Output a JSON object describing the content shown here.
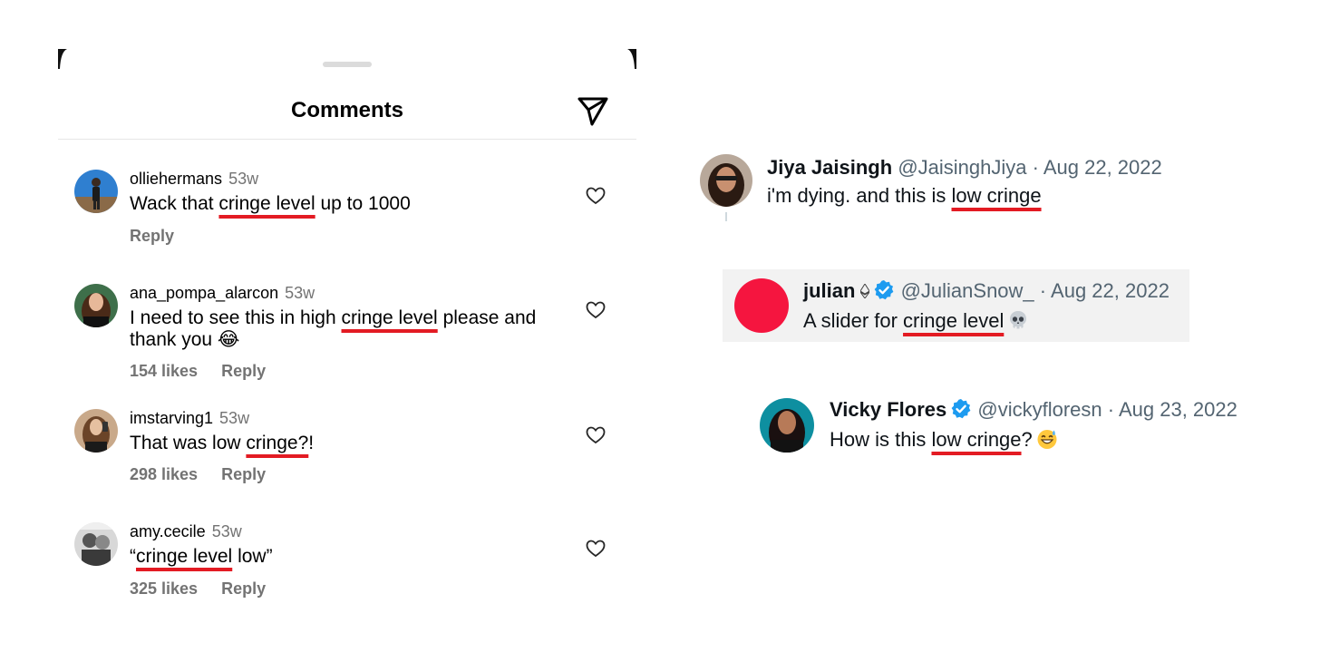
{
  "instagram": {
    "title": "Comments",
    "icons": {
      "send": "send-icon",
      "like": "heart-icon"
    },
    "comments": [
      {
        "username": "olliehermans",
        "time": "53w",
        "text_before": "Wack that ",
        "highlight": "cringe level",
        "text_after": " up to 1000",
        "likes": "",
        "reply": "Reply"
      },
      {
        "username": "ana_pompa_alarcon",
        "time": "53w",
        "text_before": "I need to see this in high ",
        "highlight": "cringe level",
        "text_after": " please and thank you 😂",
        "likes": "154 likes",
        "reply": "Reply"
      },
      {
        "username": "imstarving1",
        "time": "53w",
        "text_before": "That was low ",
        "highlight": "cringe?",
        "text_after": "!",
        "likes": "298 likes",
        "reply": "Reply"
      },
      {
        "username": "amy.cecile",
        "time": "53w",
        "text_before": "“",
        "highlight": "cringe level",
        "text_after": " low”",
        "likes": "325 likes",
        "reply": "Reply"
      }
    ]
  },
  "twitter": [
    {
      "name": "Jiya Jaisingh",
      "handle": "@JaisinghJiya",
      "separator": "·",
      "date": "Aug 22, 2022",
      "text_before": "i'm dying. and this is ",
      "highlight": "low cringe",
      "text_after": ""
    },
    {
      "name": "julian",
      "handle": "@JulianSnow_",
      "separator": "·",
      "date": "Aug 22, 2022",
      "text_before": "A slider for ",
      "highlight": "cringe level",
      "text_after": "",
      "emoji": "skull-emoji"
    },
    {
      "name": "Vicky Flores",
      "handle": "@vickyfloresn",
      "separator": "·",
      "date": "Aug 23, 2022",
      "text_before": "How is this ",
      "highlight": "low cringe",
      "text_after": "?",
      "emoji": "grinning-sweat-emoji"
    }
  ],
  "colors": {
    "highlight_underline": "#e31b23",
    "ig_secondary_text": "#737373",
    "tw_secondary_text": "#536471",
    "verified_blue": "#1d9bf0",
    "julian_avatar": "#f5153f"
  }
}
